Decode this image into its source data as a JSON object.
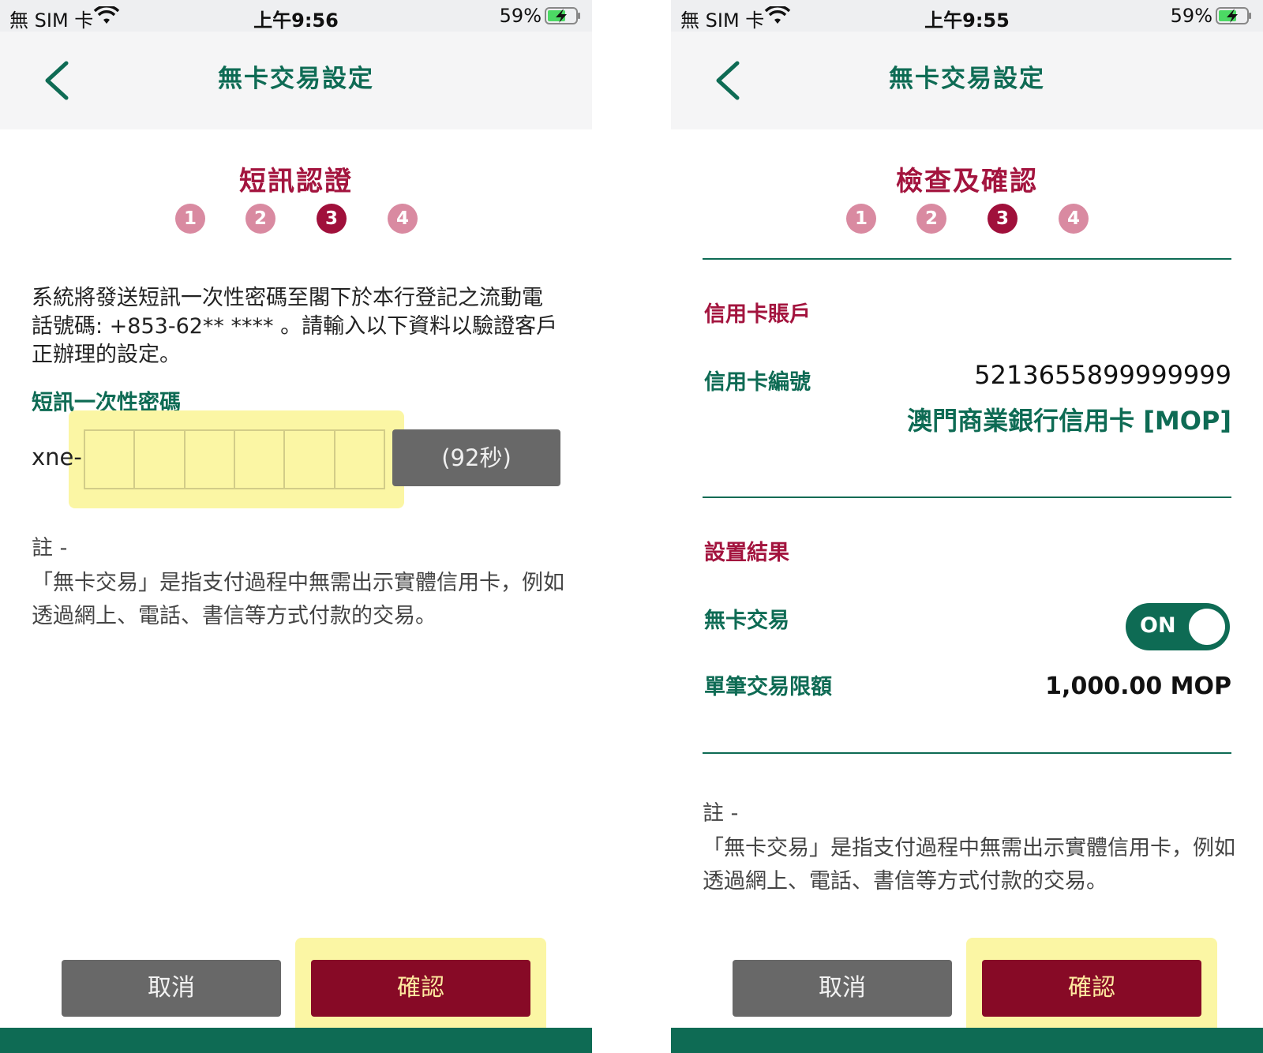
{
  "colors": {
    "brand_green": "#0e6b54",
    "brand_red": "#a3143e",
    "step_inactive": "#d98aa1",
    "step_active": "#a0103b",
    "confirm_button": "#870a26",
    "cancel_button": "#686868",
    "highlight": "#fbf6a4"
  },
  "left": {
    "status": {
      "carrier": "無 SIM 卡",
      "wifi_icon": "wifi-icon",
      "time": "上午9:56",
      "battery_pct": "59%",
      "battery_icon": "battery-charging-icon"
    },
    "nav": {
      "title": "無卡交易設定",
      "back_icon": "chevron-left-icon"
    },
    "step_title": "短訊認證",
    "steps": [
      "1",
      "2",
      "3",
      "4"
    ],
    "active_step": 3,
    "instruction": "系統將發送短訊一次性密碼至閣下於本行登記之流動電話號碼: +853-62** **** 。請輸入以下資料以驗證客戶正辦理的設定。",
    "otp_label": "短訊一次性密碼",
    "otp_prefix": "xne-",
    "otp_digits": [
      "",
      "",
      "",
      "",
      "",
      ""
    ],
    "resend_label": "(92秒)",
    "note_head": "註 -",
    "note_text": "「無卡交易」是指支付過程中無需出示實體信用卡，例如透過網上、電話、書信等方式付款的交易。",
    "cancel_label": "取消",
    "confirm_label": "確認"
  },
  "right": {
    "status": {
      "carrier": "無 SIM 卡",
      "wifi_icon": "wifi-icon",
      "time": "上午9:55",
      "battery_pct": "59%",
      "battery_icon": "battery-charging-icon"
    },
    "nav": {
      "title": "無卡交易設定",
      "back_icon": "chevron-left-icon"
    },
    "step_title": "檢查及確認",
    "steps": [
      "1",
      "2",
      "3",
      "4"
    ],
    "active_step": 3,
    "section_account": "信用卡賬戶",
    "card_number_label": "信用卡編號",
    "card_number": "5213655899999999",
    "card_name": "澳門商業銀行信用卡 [MOP]",
    "section_result": "設置結果",
    "cardless_label": "無卡交易",
    "toggle_state": "ON",
    "limit_label": "單筆交易限額",
    "limit_value": "1,000.00 MOP",
    "note_head": "註 -",
    "note_text": "「無卡交易」是指支付過程中無需出示實體信用卡，例如透過網上、電話、書信等方式付款的交易。",
    "cancel_label": "取消",
    "confirm_label": "確認"
  }
}
